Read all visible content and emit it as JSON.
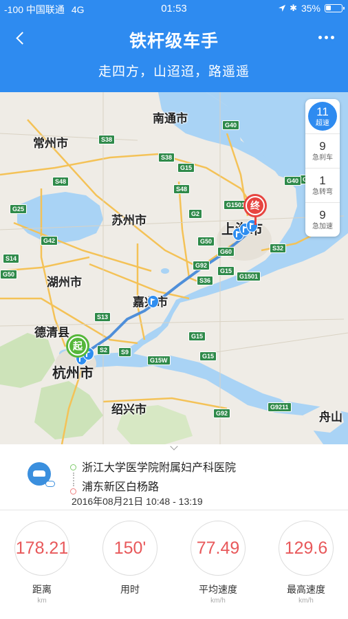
{
  "status_bar": {
    "carrier": "-100 中国联通",
    "network": "4G",
    "time": "01:53",
    "battery_text": "35%",
    "battery_level": 0.35
  },
  "header": {
    "title": "铁杆级车手",
    "subtitle": "走四方，山迢迢，路遥遥",
    "back_icon": "chevron-left-icon",
    "more_icon": "more-dots-icon",
    "background": "#2e8bf0"
  },
  "map": {
    "cities": [
      {
        "name": "南通市"
      },
      {
        "name": "常州市"
      },
      {
        "name": "苏州市"
      },
      {
        "name": "上海市"
      },
      {
        "name": "湖州市"
      },
      {
        "name": "嘉兴市"
      },
      {
        "name": "德清县"
      },
      {
        "name": "杭州市"
      },
      {
        "name": "绍兴市"
      },
      {
        "name": "舟山"
      }
    ],
    "road_labels": [
      "G40",
      "S38",
      "S38",
      "G15",
      "S48",
      "S48",
      "G2",
      "G25",
      "G1501",
      "G42",
      "G50",
      "G60",
      "S32",
      "G42",
      "S14",
      "G50",
      "G92",
      "G15",
      "G1501",
      "S36",
      "S13",
      "G15",
      "S9",
      "G15W",
      "G15",
      "S2",
      "G92",
      "G9211",
      "G40"
    ],
    "start_marker": "起",
    "end_marker": "终",
    "route_color": "#4f8fd9"
  },
  "events": [
    {
      "count": "11",
      "label": "超速"
    },
    {
      "count": "9",
      "label": "急刹车"
    },
    {
      "count": "1",
      "label": "急转弯"
    },
    {
      "count": "9",
      "label": "急加速"
    }
  ],
  "trip": {
    "from": "浙江大学医学院附属妇产科医院",
    "to": "浦东新区白杨路",
    "time": "2016年08月21日 10:48 - 13:19"
  },
  "metrics": [
    {
      "value": "178.21",
      "label": "距离",
      "unit": "km"
    },
    {
      "value": "150'",
      "label": "用时",
      "unit": ""
    },
    {
      "value": "77.49",
      "label": "平均速度",
      "unit": "km/h"
    },
    {
      "value": "129.6",
      "label": "最高速度",
      "unit": "km/h"
    }
  ],
  "colors": {
    "accent": "#2e8bf0",
    "metric_value": "#e8585a",
    "start_green": "#55b73a",
    "end_red": "#e74440"
  }
}
